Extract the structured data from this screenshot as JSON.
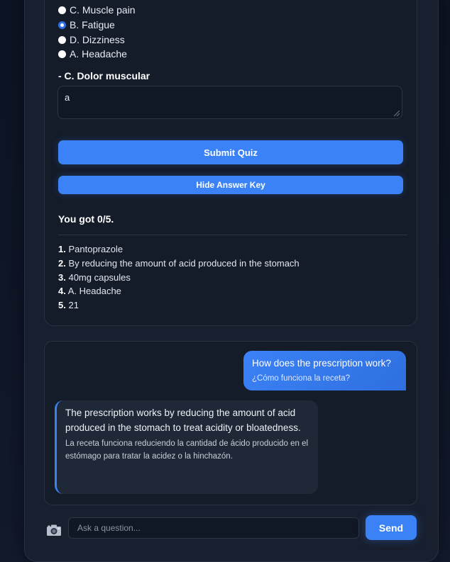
{
  "quiz": {
    "options": [
      {
        "label": "C. Muscle pain",
        "selected": false
      },
      {
        "label": "B. Fatigue",
        "selected": true
      },
      {
        "label": "D. Dizziness",
        "selected": false
      },
      {
        "label": "A. Headache",
        "selected": false
      }
    ],
    "question_title": "- C. Dolor muscular",
    "answer_value": "a",
    "submit_label": "Submit Quiz",
    "hide_key_label": "Hide Answer Key",
    "score_text": "You got 0/5.",
    "answer_key": [
      {
        "num": "1.",
        "text": "Pantoprazole"
      },
      {
        "num": "2.",
        "text": "By reducing the amount of acid produced in the stomach"
      },
      {
        "num": "3.",
        "text": "40mg capsules"
      },
      {
        "num": "4.",
        "text": "A. Headache"
      },
      {
        "num": "5.",
        "text": "21"
      }
    ]
  },
  "chat": {
    "user_message": {
      "text": "How does the prescription work?",
      "translation": "¿Cómo funciona la receta?"
    },
    "bot_message": {
      "text": "The prescription works by reducing the amount of acid produced in the stomach to treat acidity or bloatedness.",
      "translation": "La receta funciona reduciendo la cantidad de ácido producido en el estómago para tratar la acidez o la hinchazón."
    }
  },
  "composer": {
    "camera_icon": "camera-icon",
    "placeholder": "Ask a question...",
    "send_label": "Send"
  },
  "colors": {
    "accent": "#3b82f6",
    "background": "#0f1729",
    "card": "#141c2a"
  }
}
